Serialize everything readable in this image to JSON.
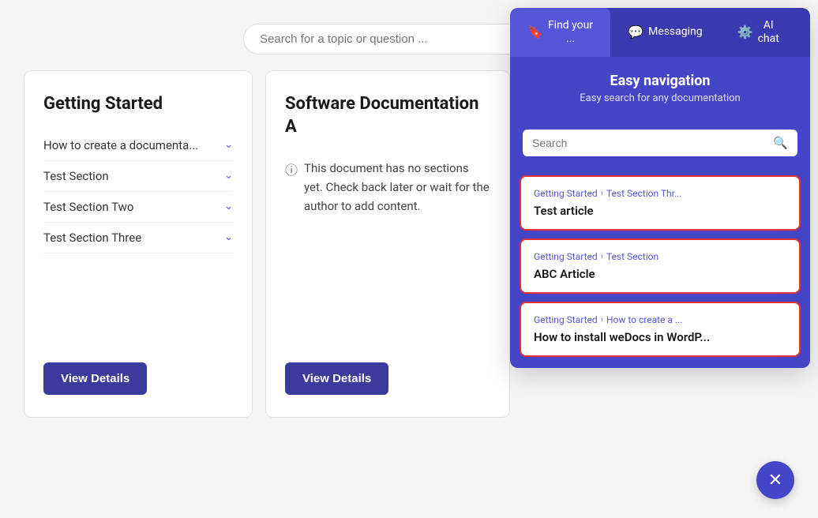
{
  "search": {
    "placeholder": "Search for a topic or question ..."
  },
  "nav": {
    "tabs": [
      {
        "id": "find",
        "label": "Find your\n...",
        "icon": "🔖",
        "active": true
      },
      {
        "id": "messaging",
        "label": "Messaging",
        "icon": "💬",
        "active": false
      },
      {
        "id": "ai_chat",
        "label": "AI\nchat",
        "icon": "⚙️",
        "active": false
      }
    ]
  },
  "cards": [
    {
      "id": "getting-started",
      "title": "Getting Started",
      "sections": [
        {
          "label": "How to create a documenta..."
        },
        {
          "label": "Test Section"
        },
        {
          "label": "Test Section Two"
        },
        {
          "label": "Test Section Three"
        }
      ],
      "viewDetails": "View Details"
    },
    {
      "id": "software-doc-a",
      "title": "Software Documentation A",
      "infoMsg": "This document has no sections yet. Check back later or wait for the author to add content.",
      "viewDetails": "View Details"
    }
  ],
  "popup": {
    "header": {
      "title": "Easy navigation",
      "subtitle": "Easy search for any documentation"
    },
    "search": {
      "placeholder": "Search"
    },
    "results": [
      {
        "id": "result-1",
        "breadcrumb": [
          "Getting Started",
          "Test Section Thr..."
        ],
        "title": "Test article",
        "highlighted": true
      },
      {
        "id": "result-2",
        "breadcrumb": [
          "Getting Started",
          "Test Section"
        ],
        "title": "ABC Article",
        "highlighted": true
      },
      {
        "id": "result-3",
        "breadcrumb": [
          "Getting Started",
          "How to create a ..."
        ],
        "title": "How to install weDocs in WordP...",
        "highlighted": true
      }
    ]
  },
  "close_btn": "✕"
}
